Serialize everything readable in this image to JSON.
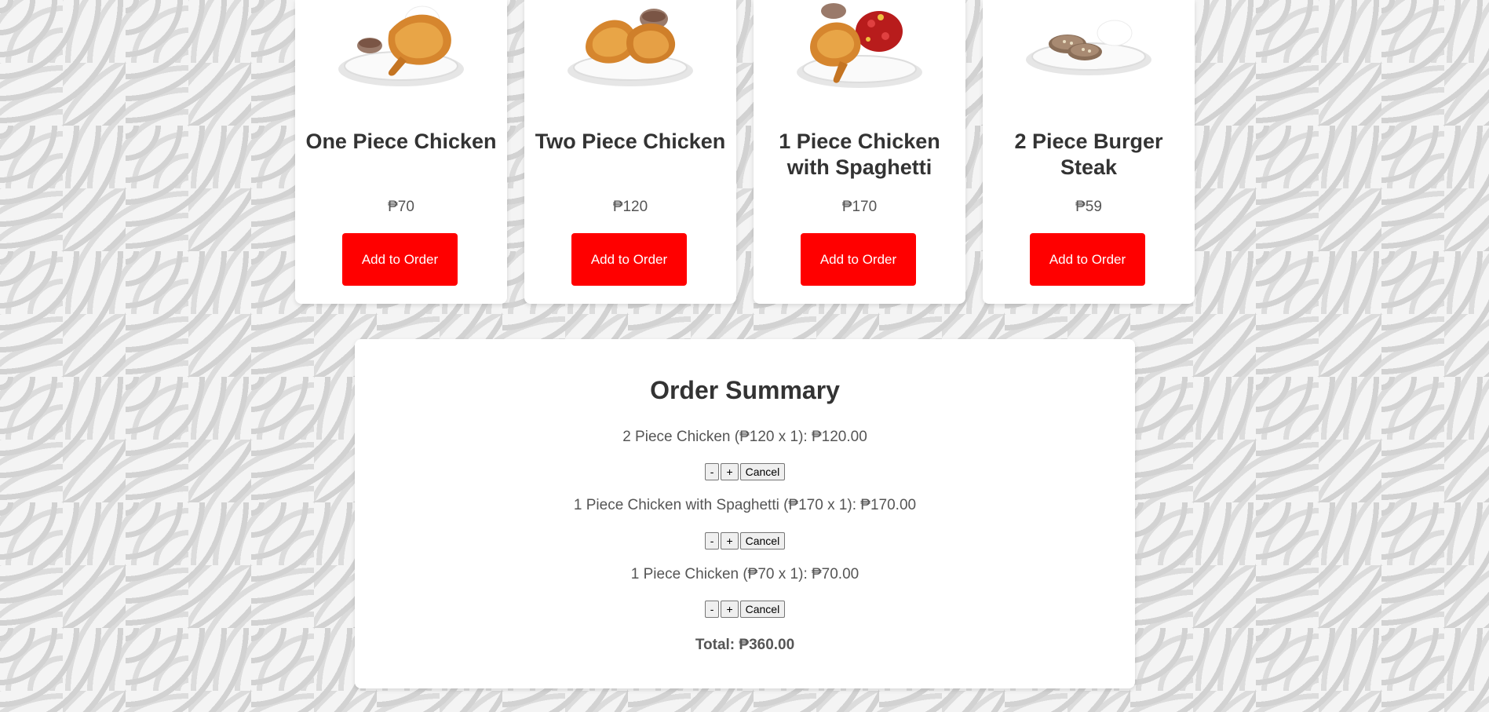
{
  "menu": {
    "items": [
      {
        "name": "One Piece Chicken",
        "price": "₱70",
        "button": "Add to Order",
        "image": "fried-chicken-one-piece"
      },
      {
        "name": "Two Piece Chicken",
        "price": "₱120",
        "button": "Add to Order",
        "image": "fried-chicken-two-piece"
      },
      {
        "name": "1 Piece Chicken with Spaghetti",
        "price": "₱170",
        "button": "Add to Order",
        "image": "chicken-with-spaghetti"
      },
      {
        "name": "2 Piece Burger Steak",
        "price": "₱59",
        "button": "Add to Order",
        "image": "burger-steak"
      }
    ]
  },
  "summary": {
    "title": "Order Summary",
    "lines": [
      {
        "text": "2 Piece Chicken (₱120 x 1): ₱120.00",
        "minus": "-",
        "plus": "+",
        "cancel": "Cancel"
      },
      {
        "text": "1 Piece Chicken with Spaghetti (₱170 x 1): ₱170.00",
        "minus": "-",
        "plus": "+",
        "cancel": "Cancel"
      },
      {
        "text": "1 Piece Chicken (₱70 x 1): ₱70.00",
        "minus": "-",
        "plus": "+",
        "cancel": "Cancel"
      }
    ],
    "total": "Total: ₱360.00"
  },
  "colors": {
    "accent": "#ff0000",
    "card": "#ffffff",
    "text": "#333333"
  }
}
